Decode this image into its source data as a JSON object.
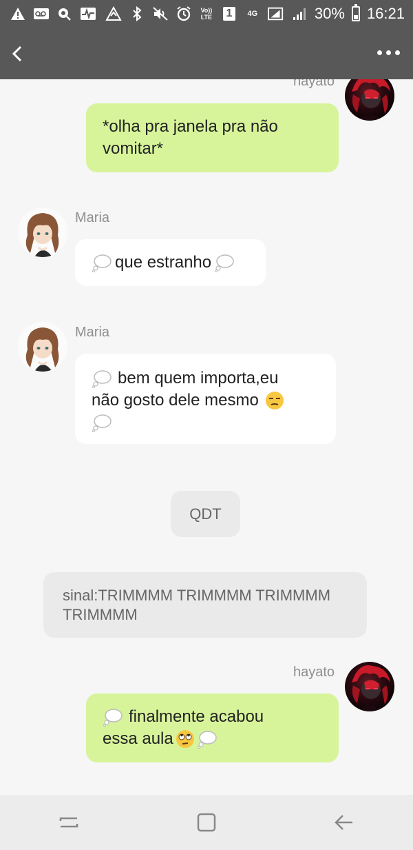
{
  "status_bar": {
    "battery_percent": "30%",
    "time": "16:21",
    "volte_label": "Vo)) LTE",
    "sim_label": "1",
    "network_label": "4G"
  },
  "header": {
    "back_icon": "chevron-left-icon",
    "more_icon": "more-horizontal-icon"
  },
  "messages": [
    {
      "sender": "hayato",
      "side": "right",
      "text": "*olha pra janela pra não vomitar*"
    },
    {
      "sender": "Maria",
      "side": "left",
      "text": "que estranho"
    },
    {
      "sender": "Maria",
      "side": "left",
      "text_line1": "bem quem importa,eu",
      "text_line2": "não gosto dele mesmo"
    },
    {
      "sender": "",
      "side": "center",
      "text": "QDT"
    },
    {
      "sender": "",
      "side": "center",
      "text": "sinal:TRIMMMM TRIMMMM TRIMMMM TRIMMMM"
    },
    {
      "sender": "hayato",
      "side": "right",
      "text_line1": "finalmente acabou",
      "text_line2": "essa aula"
    }
  ],
  "navbar": {
    "recent_icon": "recent-apps-icon",
    "home_icon": "home-icon",
    "back_icon": "back-arrow-icon"
  },
  "colors": {
    "bar_bg": "#585858",
    "my_bubble": "#d7f49a",
    "their_bubble": "#ffffff",
    "system_bubble": "#eaeaea"
  }
}
